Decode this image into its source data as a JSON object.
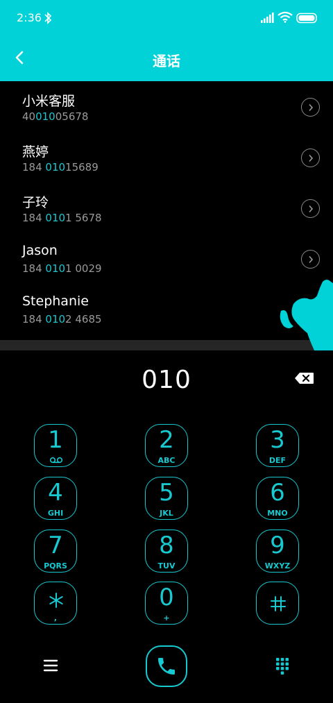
{
  "status_bar": {
    "time": "2:36"
  },
  "header": {
    "title": "通话"
  },
  "contacts": [
    {
      "name": "小米客服",
      "number_pre": "40",
      "number_match": "010",
      "number_post": "05678"
    },
    {
      "name": "燕婷",
      "number_pre": "184 ",
      "number_match": "010",
      "number_post": "15689"
    },
    {
      "name": "子玲",
      "number_pre": "184 ",
      "number_match": "010",
      "number_post": "1 5678"
    },
    {
      "name": "Jason",
      "number_pre": "184 ",
      "number_match": "010",
      "number_post": "1 0029"
    },
    {
      "name": "Stephanie",
      "number_pre": "184 ",
      "number_match": "010",
      "number_post": "2 4685"
    }
  ],
  "dialpad": {
    "input": "010",
    "keys": [
      {
        "digit": "1",
        "letters": "",
        "sub_icon": "voicemail-icon"
      },
      {
        "digit": "2",
        "letters": "ABC"
      },
      {
        "digit": "3",
        "letters": "DEF"
      },
      {
        "digit": "4",
        "letters": "GHI"
      },
      {
        "digit": "5",
        "letters": "JKL"
      },
      {
        "digit": "6",
        "letters": "MNO"
      },
      {
        "digit": "7",
        "letters": "PQRS"
      },
      {
        "digit": "8",
        "letters": "TUV"
      },
      {
        "digit": "9",
        "letters": "WXYZ"
      },
      {
        "digit": "",
        "letters": ",",
        "icon": "asterisk-icon"
      },
      {
        "digit": "0",
        "letters": "+"
      },
      {
        "digit": "",
        "letters": "",
        "icon": "hash-icon"
      }
    ]
  },
  "colors": {
    "accent": "#00d2d8",
    "key": "#17c9d1",
    "match": "#1ec6cf",
    "muted": "#9a9a9a"
  },
  "icons": {
    "status": [
      "bluetooth-icon",
      "signal-icon",
      "wifi-icon",
      "battery-icon"
    ],
    "header": "back-arrow-icon",
    "row": "chevron-right-icon",
    "dialpad": "backspace-icon",
    "bottom": [
      "menu-icon",
      "phone-icon",
      "keypad-icon"
    ]
  }
}
